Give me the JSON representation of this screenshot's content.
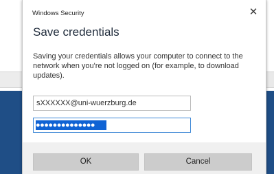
{
  "dialog": {
    "window_title": "Windows Security",
    "close_glyph": "✕",
    "heading": "Save credentials",
    "description": "Saving your credentials allows your computer to connect to the network when you're not logged on (for example, to download updates).",
    "username_value": "sXXXXXX@uni-wuerzburg.de",
    "password_mask": "●●●●●●●●●●●●●●",
    "ok_label": "OK",
    "cancel_label": "Cancel"
  },
  "colors": {
    "password_selection": "#0f63d4",
    "focus_border": "#3c87d6",
    "button_bg": "#cccccc",
    "background_blue": "#1f4e86"
  }
}
